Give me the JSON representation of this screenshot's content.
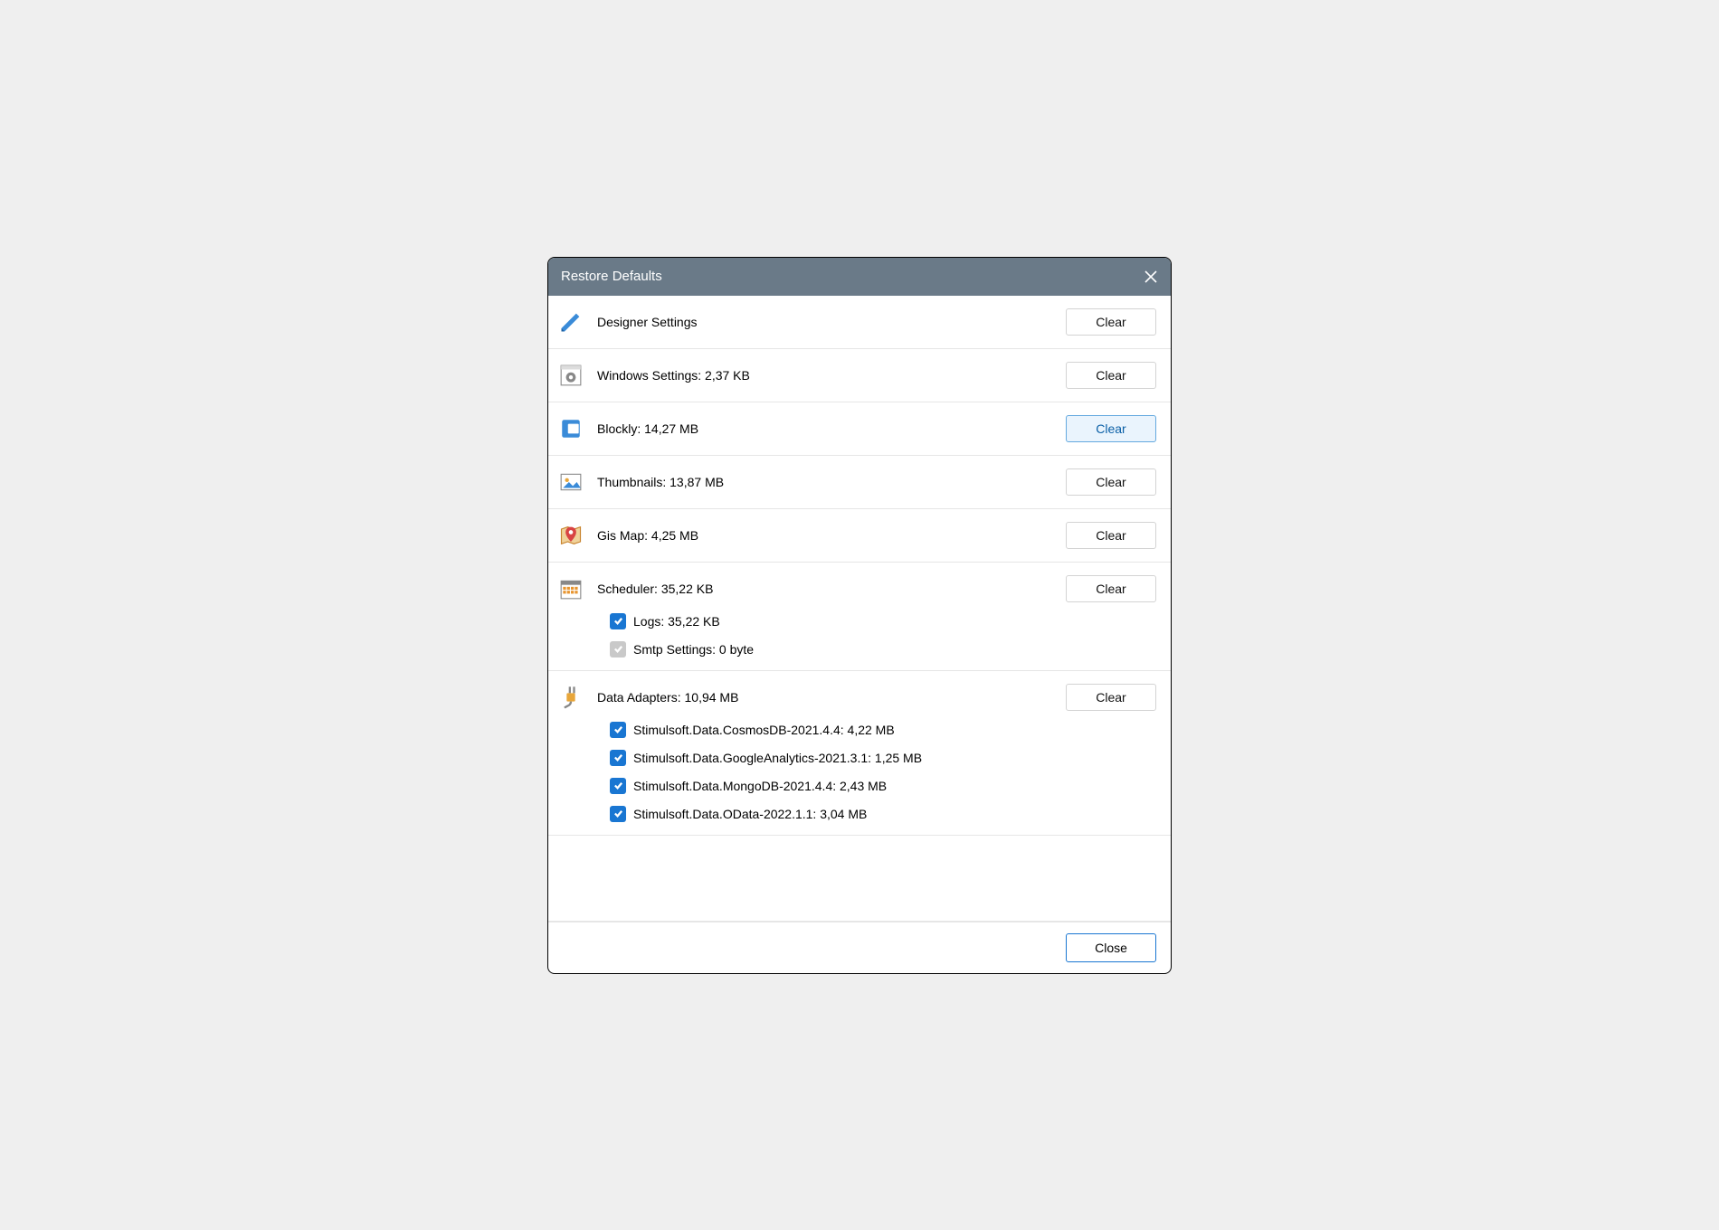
{
  "title": "Restore Defaults",
  "clear_label": "Clear",
  "close_label": "Close",
  "sections": [
    {
      "label": "Designer Settings",
      "highlighted": false
    },
    {
      "label": "Windows Settings: 2,37 KB",
      "highlighted": false
    },
    {
      "label": "Blockly: 14,27 MB",
      "highlighted": true
    },
    {
      "label": "Thumbnails: 13,87 MB",
      "highlighted": false
    },
    {
      "label": "Gis Map: 4,25 MB",
      "highlighted": false
    },
    {
      "label": "Scheduler: 35,22 KB",
      "highlighted": false,
      "children": [
        {
          "label": "Logs: 35,22 KB",
          "checked": true,
          "disabled": false
        },
        {
          "label": "Smtp Settings: 0 byte",
          "checked": true,
          "disabled": true
        }
      ]
    },
    {
      "label": "Data Adapters: 10,94 MB",
      "highlighted": false,
      "children": [
        {
          "label": "Stimulsoft.Data.CosmosDB-2021.4.4: 4,22 MB",
          "checked": true,
          "disabled": false
        },
        {
          "label": "Stimulsoft.Data.GoogleAnalytics-2021.3.1: 1,25 MB",
          "checked": true,
          "disabled": false
        },
        {
          "label": "Stimulsoft.Data.MongoDB-2021.4.4: 2,43 MB",
          "checked": true,
          "disabled": false
        },
        {
          "label": "Stimulsoft.Data.OData-2022.1.1: 3,04 MB",
          "checked": true,
          "disabled": false
        }
      ]
    }
  ]
}
